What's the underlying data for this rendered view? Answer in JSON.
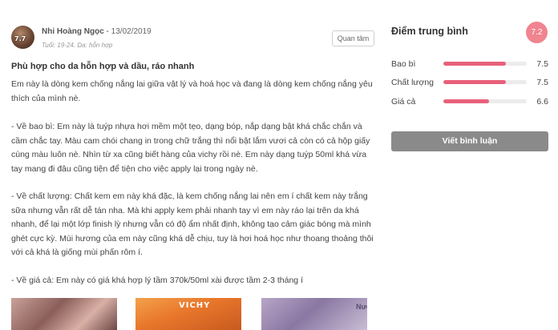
{
  "review": {
    "avatar_badge": "7.7",
    "user_name": "Nhi Hoàng Ngọc",
    "separator": " - ",
    "date": "13/02/2019",
    "meta": "Tuổi: 19-24. Da: hỗn hợp",
    "follow_label": "Quan tâm",
    "title": "Phù hợp cho da hỗn hợp và dầu, ráo nhanh",
    "paragraphs": [
      "Em này là dòng kem chống nắng lai giữa vật lý và hoá học và đang là dòng kem chống nắng yêu thích của mình nè.",
      "- Về bao bì: Em này là tuýp nhựa hơi mềm một tẹo, dạng bóp, nắp dạng bật khá chắc chắn và cầm chắc tay. Màu cam chói chang in trong chữ trắng thì nổi bật lắm vươi cả còn có cả hộp giấy cùng màu luôn nè. Nhìn từ xa cũng biết hàng của vichy rồi nè. Em này dạng tuýp 50ml khá vừa tay mang đi đâu cũng tiện để tiện cho việc apply lại trong ngày nè.",
      "- Về chất lượng: Chất kem em này khá đặc, là kem chống nắng lai nên em í chất kem này trắng sữa nhưng vẫn rất dễ tán nha. Mà khi apply kem phải nhanh tay vì em này ráo lại trên da khá nhanh, để lại một lớp finish lỳ nhưng vẫn có độ ẩm nhất định, không tạo cảm giác bóng mà mình ghét cực kỳ. Mùi hương của em này cũng khá dễ chịu, tuy là hơi hoá học như thoang thoảng thôi với cả khá là giống mùi phấn rôm í.",
      "- Về giá cả: Em này có giá khá hợp lý tầm 370k/50ml xài được tầm 2-3 tháng í"
    ],
    "thumb_texts": [
      "VICHY",
      "Nước"
    ]
  },
  "sidebar": {
    "avg_title": "Điểm trung bình",
    "avg_score": "7.2",
    "ratings": [
      {
        "label": "Bao bì",
        "value": "7.5",
        "fraction": 0.75
      },
      {
        "label": "Chất lượng",
        "value": "7.5",
        "fraction": 0.75
      },
      {
        "label": "Giá cả",
        "value": "6.6",
        "fraction": 0.55
      }
    ],
    "write_button": "Viết bình luận"
  },
  "colors": {
    "accent_pink": "#e8607a",
    "badge_pink": "#f0848f",
    "button_gray": "#8a8a8a"
  }
}
